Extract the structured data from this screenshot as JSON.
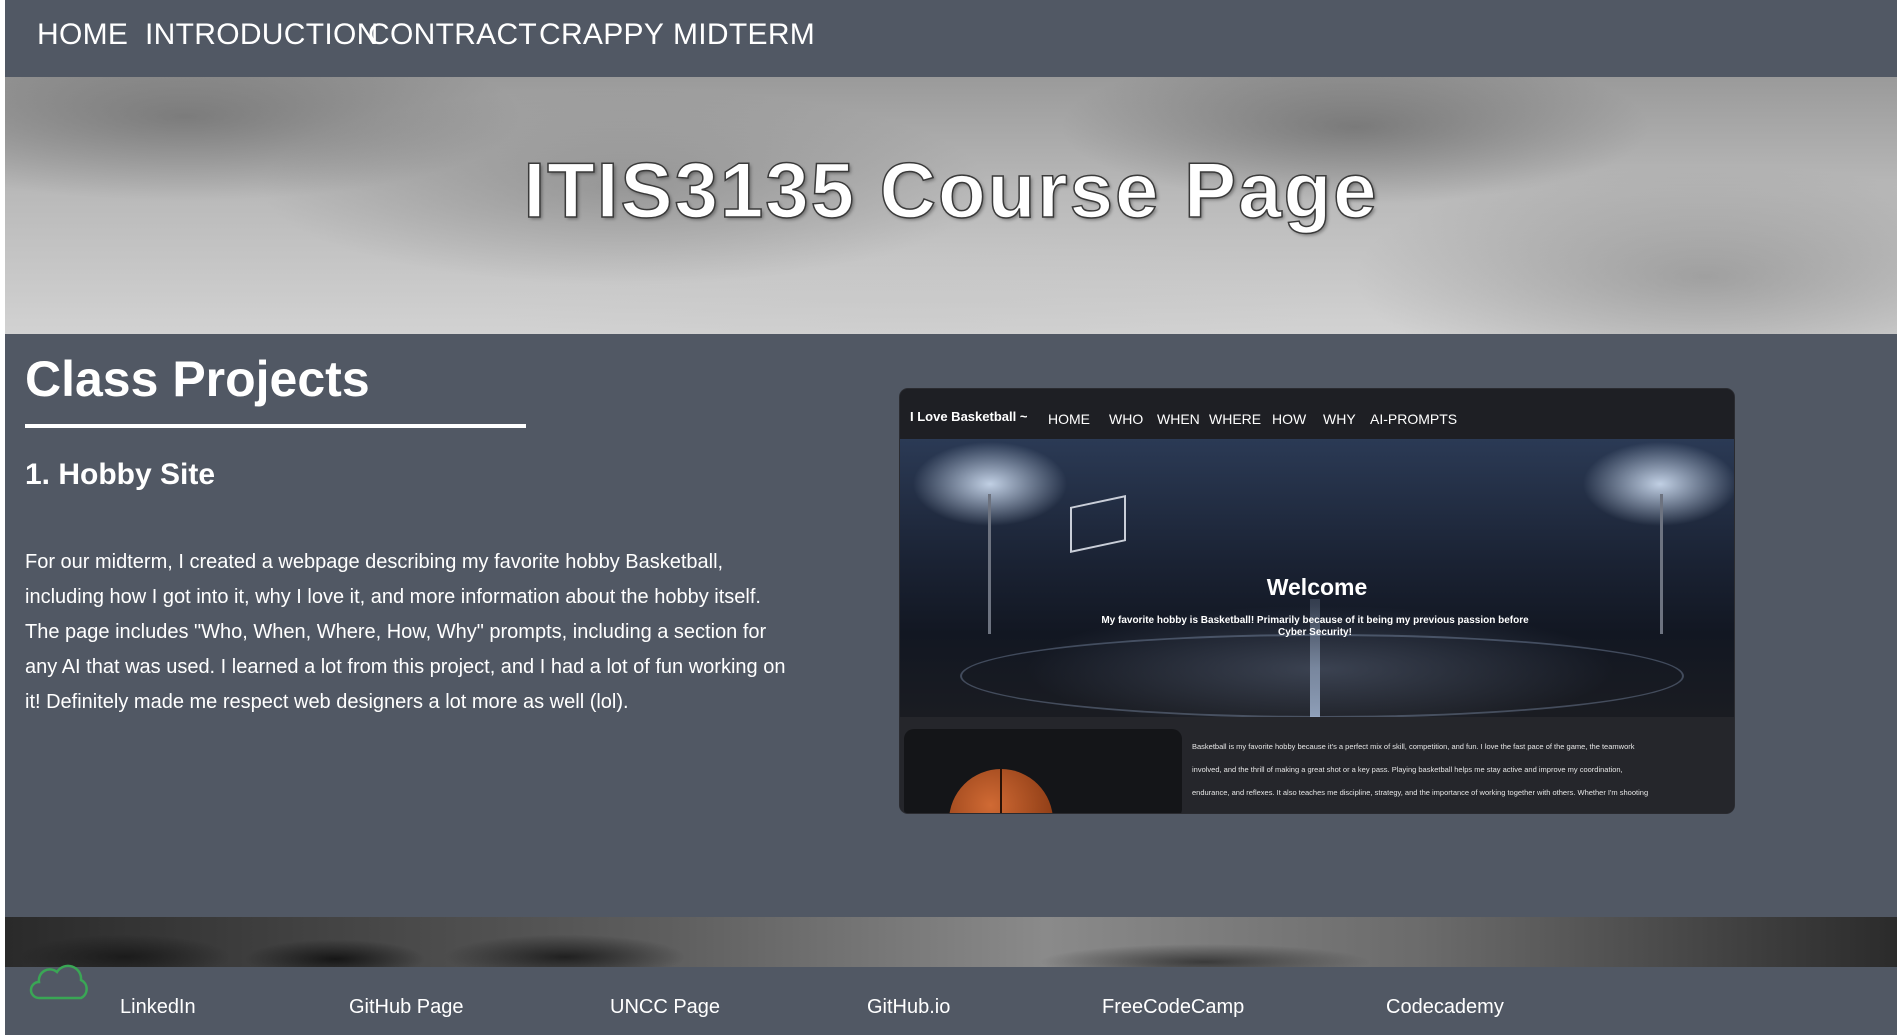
{
  "nav": {
    "items": [
      {
        "label": "HOME"
      },
      {
        "label": "INTRODUCTION"
      },
      {
        "label": "CONTRACT"
      },
      {
        "label": "CRAPPY"
      },
      {
        "label": "MIDTERM"
      }
    ]
  },
  "hero": {
    "title": "ITIS3135 Course Page"
  },
  "main": {
    "heading": "Class Projects",
    "project": {
      "title": "1. Hobby Site",
      "description": "For our midterm, I created a webpage describing my favorite hobby Basketball, including how I got into it, why I love it, and more information about the hobby itself. The page includes \"Who, When, Where, How, Why\" prompts, including a section for any AI that was used. I learned a lot from this project, and I had a lot of fun working on it! Definitely made me respect web designers a lot more as well (lol)."
    },
    "preview": {
      "brand": "I Love Basketball ~",
      "links": [
        "HOME",
        "WHO",
        "WHEN",
        "WHERE",
        "HOW",
        "WHY",
        "AI-PROMPTS"
      ],
      "welcome": "Welcome",
      "subtitle": "My favorite hobby is Basketball! Primarily because of it being my previous passion before Cyber Security!",
      "body_lines": [
        "Basketball is my favorite hobby because it's a perfect mix of skill, competition, and fun. I love the fast pace of the game, the teamwork",
        "involved, and the thrill of making a great shot or a key pass. Playing basketball helps me stay active and improve my coordination,",
        "endurance, and reflexes. It also teaches me discipline, strategy, and the importance of working together with others. Whether I'm shooting"
      ]
    }
  },
  "footer": {
    "icon": "cloud-icon",
    "links": [
      {
        "label": "LinkedIn"
      },
      {
        "label": "GitHub Page"
      },
      {
        "label": "UNCC Page"
      },
      {
        "label": "GitHub.io"
      },
      {
        "label": "FreeCodeCamp"
      },
      {
        "label": "Codecademy"
      }
    ]
  },
  "colors": {
    "page_bg": "#515864",
    "text": "#ffffff",
    "cloud_icon": "#3aa655"
  }
}
